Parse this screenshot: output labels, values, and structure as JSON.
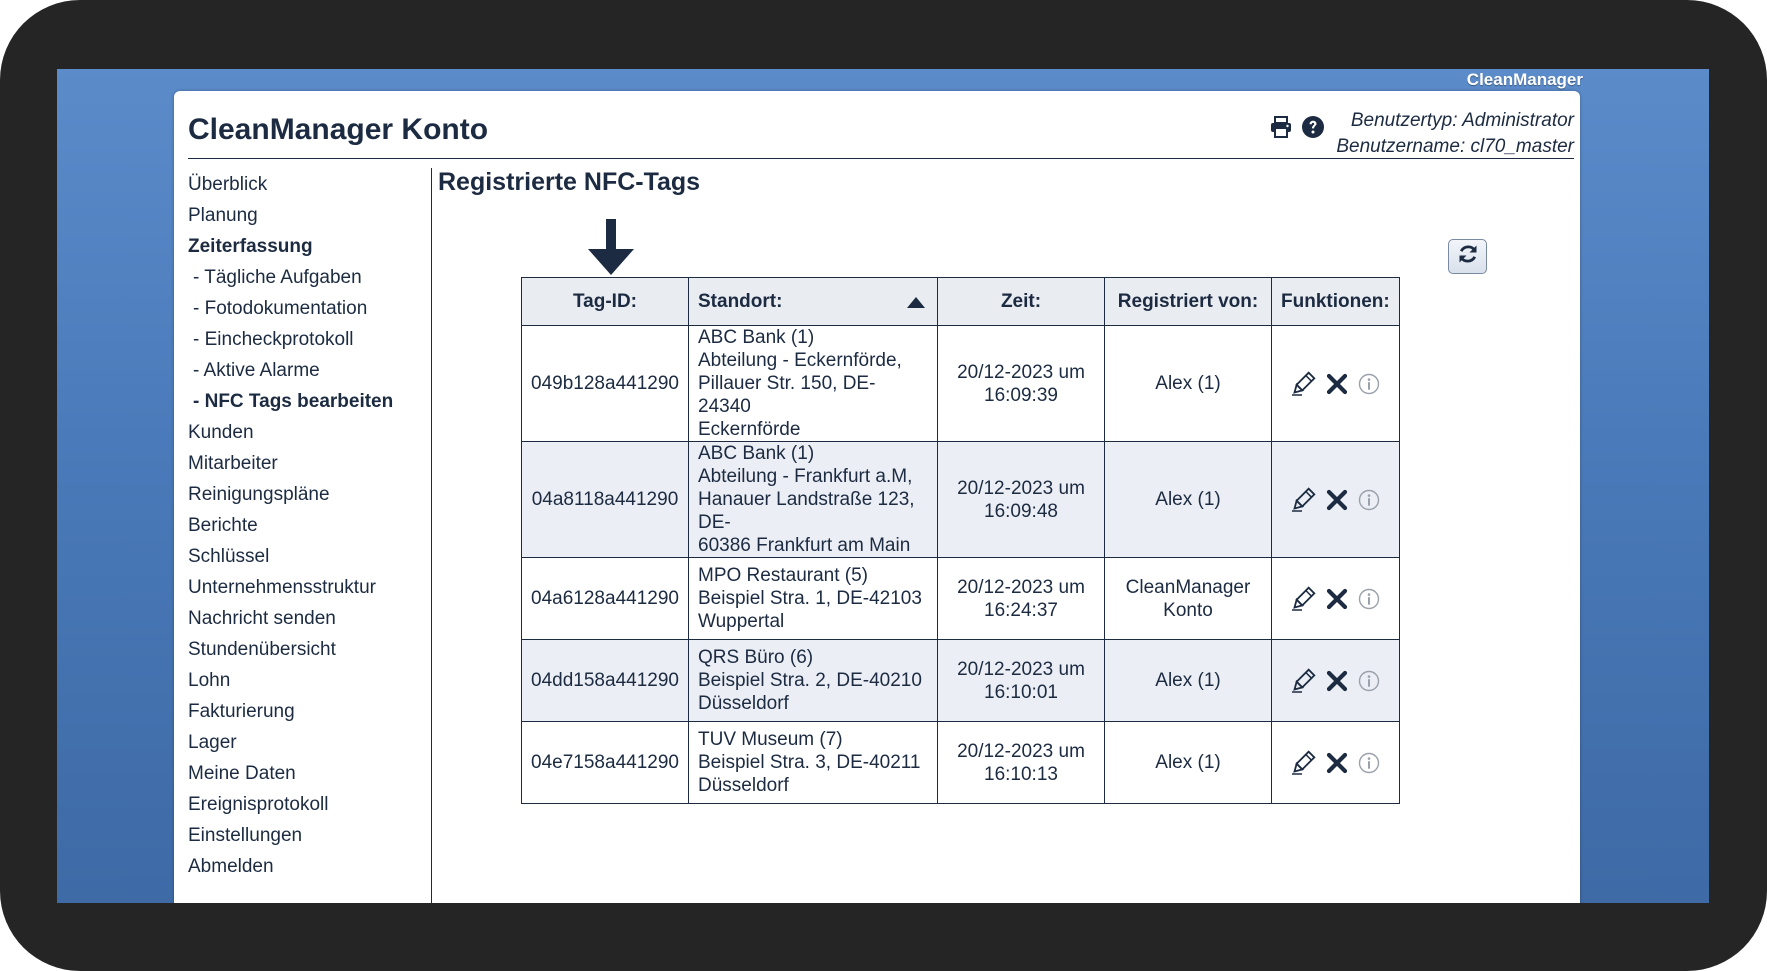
{
  "brand": "CleanManager",
  "header": {
    "title": "CleanManager Konto",
    "user_type": "Benutzertyp: Administrator",
    "user_name": "Benutzername: cl70_master"
  },
  "sidebar": {
    "items": [
      {
        "label": "Überblick",
        "style": "normal"
      },
      {
        "label": "Planung",
        "style": "normal"
      },
      {
        "label": "Zeiterfassung",
        "style": "bold"
      },
      {
        "label": "- Tägliche Aufgaben",
        "style": "sub"
      },
      {
        "label": "- Fotodokumentation",
        "style": "sub"
      },
      {
        "label": "- Eincheckprotokoll",
        "style": "sub"
      },
      {
        "label": "- Aktive Alarme",
        "style": "sub"
      },
      {
        "label": "- NFC Tags bearbeiten",
        "style": "sub-bold"
      },
      {
        "label": "Kunden",
        "style": "normal"
      },
      {
        "label": "Mitarbeiter",
        "style": "normal"
      },
      {
        "label": "Reinigungspläne",
        "style": "normal"
      },
      {
        "label": "Berichte",
        "style": "normal"
      },
      {
        "label": "Schlüssel",
        "style": "normal"
      },
      {
        "label": "Unternehmensstruktur",
        "style": "normal"
      },
      {
        "label": "Nachricht senden",
        "style": "normal"
      },
      {
        "label": "Stundenübersicht",
        "style": "normal"
      },
      {
        "label": "Lohn",
        "style": "normal"
      },
      {
        "label": "Fakturierung",
        "style": "normal"
      },
      {
        "label": "Lager",
        "style": "normal"
      },
      {
        "label": "Meine Daten",
        "style": "normal"
      },
      {
        "label": "Ereignisprotokoll",
        "style": "normal"
      },
      {
        "label": "Einstellungen",
        "style": "normal"
      },
      {
        "label": "Abmelden",
        "style": "normal"
      }
    ]
  },
  "main": {
    "title": "Registrierte NFC-Tags",
    "table": {
      "columns": [
        "Tag-ID:",
        "Standort:",
        "Zeit:",
        "Registriert von:",
        "Funktionen:"
      ],
      "rows": [
        {
          "tag_id": "049b128a441290",
          "standort": [
            "ABC Bank (1)",
            "Abteilung - Eckernförde,",
            "Pillauer Str. 150, DE-24340",
            "Eckernförde"
          ],
          "zeit": [
            "20/12-2023 um",
            "16:09:39"
          ],
          "registriert_von": [
            "Alex (1)"
          ]
        },
        {
          "tag_id": "04a8118a441290",
          "standort": [
            "ABC Bank (1)",
            "Abteilung - Frankfurt a.M,",
            "Hanauer Landstraße 123, DE-",
            "60386 Frankfurt am Main"
          ],
          "zeit": [
            "20/12-2023 um",
            "16:09:48"
          ],
          "registriert_von": [
            "Alex (1)"
          ]
        },
        {
          "tag_id": "04a6128a441290",
          "standort": [
            "MPO Restaurant (5)",
            "Beispiel Stra. 1, DE-42103",
            "Wuppertal"
          ],
          "zeit": [
            "20/12-2023 um",
            "16:24:37"
          ],
          "registriert_von": [
            "CleanManager",
            "Konto"
          ]
        },
        {
          "tag_id": "04dd158a441290",
          "standort": [
            "QRS Büro (6)",
            "Beispiel Stra. 2, DE-40210",
            "Düsseldorf"
          ],
          "zeit": [
            "20/12-2023 um",
            "16:10:01"
          ],
          "registriert_von": [
            "Alex (1)"
          ]
        },
        {
          "tag_id": "04e7158a441290",
          "standort": [
            "TUV Museum (7)",
            "Beispiel Stra. 3, DE-40211",
            "Düsseldorf"
          ],
          "zeit": [
            "20/12-2023 um",
            "16:10:13"
          ],
          "registriert_von": [
            "Alex (1)"
          ]
        }
      ]
    }
  },
  "icons": [
    "printer-icon",
    "help-icon",
    "refresh-icon",
    "sort-ascending-icon",
    "edit-pencil-icon",
    "delete-x-icon",
    "info-icon",
    "down-arrow-icon"
  ],
  "colors": {
    "text": "#1c2b41",
    "header_bg": "#e9ecf1",
    "row_shade": "#ebeef4",
    "desktop_blue": "#4a7ab9"
  }
}
